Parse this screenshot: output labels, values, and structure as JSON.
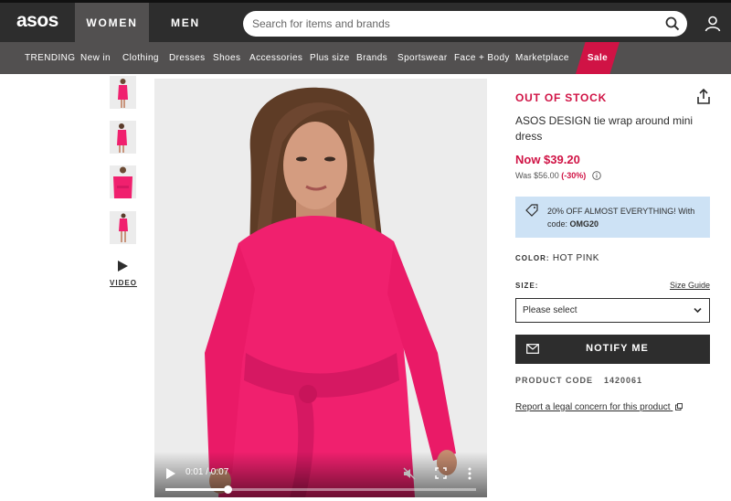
{
  "header": {
    "logo": "asos",
    "gender_tabs": [
      "WOMEN",
      "MEN"
    ],
    "search_placeholder": "Search for items and brands"
  },
  "nav": {
    "items": [
      "TRENDING",
      "New in",
      "Clothing",
      "Dresses",
      "Shoes",
      "Accessories",
      "Plus size",
      "Brands",
      "Sportswear",
      "Face + Body",
      "Marketplace"
    ],
    "sale": "Sale"
  },
  "gallery": {
    "video_label": "VIDEO"
  },
  "player": {
    "time": "0:01 / 0:07",
    "progress": 0.2
  },
  "product": {
    "stock_status": "OUT OF STOCK",
    "title": "ASOS DESIGN tie wrap around mini dress",
    "now_price": "Now $39.20",
    "was_price": "Was $56.00",
    "discount": "(-30%)",
    "promo_text": "20% OFF ALMOST EVERYTHING! With code:",
    "promo_code": "OMG20",
    "color_label": "COLOR:",
    "color_value": "HOT PINK",
    "size_label": "SIZE:",
    "size_guide": "Size Guide",
    "size_placeholder": "Please select",
    "notify_label": "NOTIFY ME",
    "product_code_label": "PRODUCT CODE",
    "product_code": "1420061",
    "legal_link": "Report a legal concern for this product"
  },
  "colors": {
    "topbar": "#2d2d2d",
    "navbar": "#525050",
    "sale": "#d01345",
    "accent_price": "#d01345",
    "promo_bg": "#cde2f5",
    "dress": "#f0206e"
  }
}
